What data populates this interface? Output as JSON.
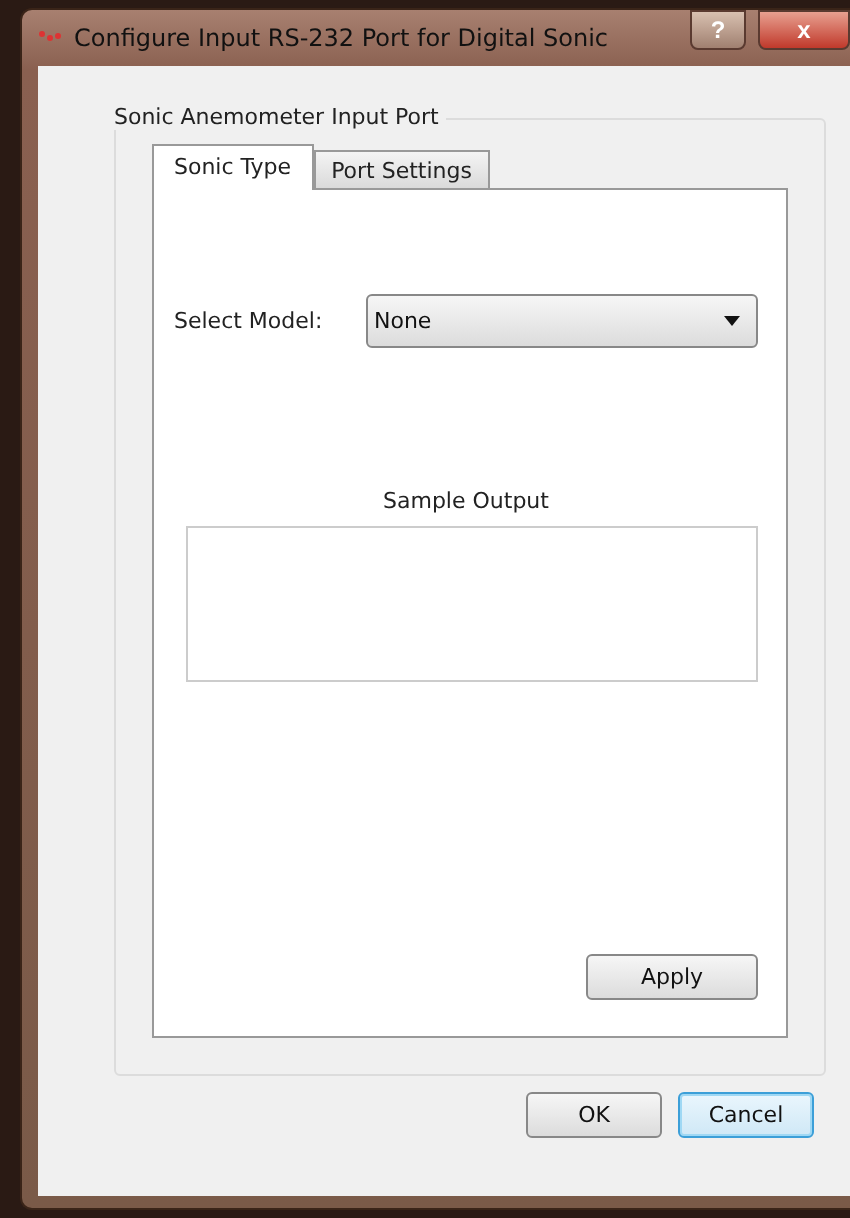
{
  "window": {
    "title": "Configure Input RS-232 Port for Digital Sonic",
    "controls": [
      {
        "kind": "help",
        "label": "?"
      },
      {
        "kind": "close",
        "label": "x"
      }
    ]
  },
  "group": {
    "title": "Sonic Anemometer Input Port"
  },
  "tabs": [
    {
      "label": "Sonic Type",
      "selected": true
    },
    {
      "label": "Port Settings",
      "selected": false
    }
  ],
  "model": {
    "label": "Select Model:",
    "value": "None"
  },
  "sample_output": {
    "label": "Sample Output"
  },
  "apply_button": "Apply",
  "buttons": [
    {
      "label": "OK",
      "default": false
    },
    {
      "label": "Cancel",
      "default": true
    }
  ]
}
